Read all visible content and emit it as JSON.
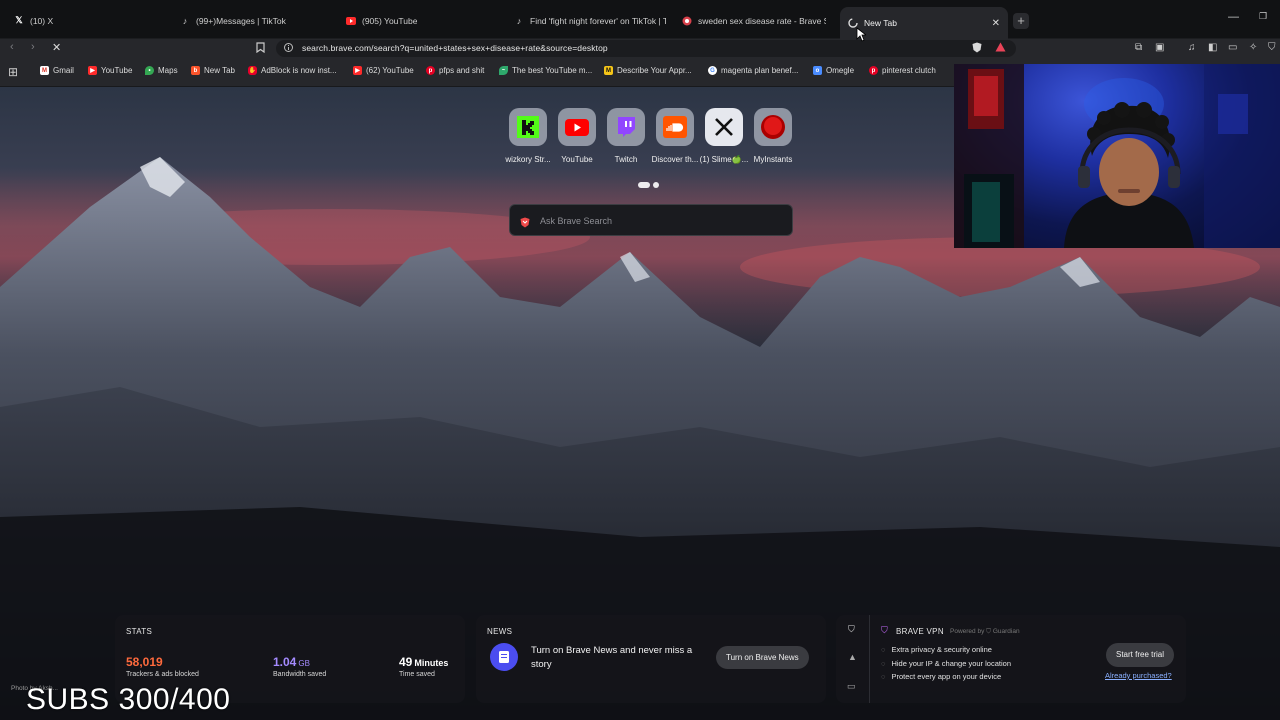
{
  "tabs": [
    {
      "title": "(10) X",
      "icon": "x-logo-icon"
    },
    {
      "title": "(99+)Messages | TikTok",
      "icon": "tiktok-icon"
    },
    {
      "title": "(905) YouTube",
      "icon": "youtube-icon"
    },
    {
      "title": "Find 'fight night forever' on TikTok | T",
      "icon": "tiktok-icon"
    },
    {
      "title": "sweden sex disease rate - Brave Searc",
      "icon": "brave-search-icon"
    },
    {
      "title": "New Tab",
      "icon": "loading-spinner-icon",
      "active": true
    }
  ],
  "toolbar": {
    "url": "search.brave.com/search?q=united+states+sex+disease+rate&source=desktop"
  },
  "bookmarks": [
    {
      "label": "Gmail",
      "icon": "gmail-icon"
    },
    {
      "label": "YouTube",
      "icon": "youtube-icon"
    },
    {
      "label": "Maps",
      "icon": "maps-icon"
    },
    {
      "label": "New Tab",
      "icon": "brave-icon"
    },
    {
      "label": "AdBlock is now inst...",
      "icon": "adblock-icon"
    },
    {
      "label": "(62) YouTube",
      "icon": "youtube-icon"
    },
    {
      "label": "pfps and shit",
      "icon": "pinterest-icon"
    },
    {
      "label": "The best YouTube m...",
      "icon": "leaf-icon"
    },
    {
      "label": "Describe Your Appr...",
      "icon": "m-icon"
    },
    {
      "label": "magenta plan benef...",
      "icon": "google-icon"
    },
    {
      "label": "Omegle",
      "icon": "omegle-icon"
    },
    {
      "label": "pinterest clutch",
      "icon": "pinterest-icon"
    }
  ],
  "top_sites": [
    {
      "label": "wizkory Str...",
      "icon": "kick-icon"
    },
    {
      "label": "YouTube",
      "icon": "youtube-icon"
    },
    {
      "label": "Twitch",
      "icon": "twitch-icon"
    },
    {
      "label": "Discover th...",
      "icon": "soundcloud-icon"
    },
    {
      "label": "(1) Slime🍏...",
      "icon": "x-logo-icon"
    },
    {
      "label": "MyInstants",
      "icon": "red-button-icon"
    }
  ],
  "search": {
    "placeholder": "Ask Brave Search"
  },
  "stats": {
    "title": "STATS",
    "trackers": {
      "value": "58,019",
      "label": "Trackers & ads blocked"
    },
    "bandwidth": {
      "value": "1.04",
      "unit": "GB",
      "label": "Bandwidth saved"
    },
    "time": {
      "value": "49",
      "unit": "Minutes",
      "label": "Time saved"
    },
    "colors": {
      "trackers": "#ff6a3d",
      "bandwidth": "#a58bff",
      "time": "#ffffff"
    }
  },
  "news": {
    "title": "NEWS",
    "headline": "Turn on Brave News and never miss a story",
    "button": "Turn on Brave News"
  },
  "vpn": {
    "title": "BRAVE VPN",
    "powered": "Powered by",
    "partner": "Guardian",
    "features": [
      "Extra privacy & security online",
      "Hide your IP & change your location",
      "Protect every app on your device"
    ],
    "cta": "Start free trial",
    "link": "Already purchased?"
  },
  "overlay": {
    "subs": "SUBS 300/400",
    "photo_credit": "Photo by Aksh..."
  }
}
